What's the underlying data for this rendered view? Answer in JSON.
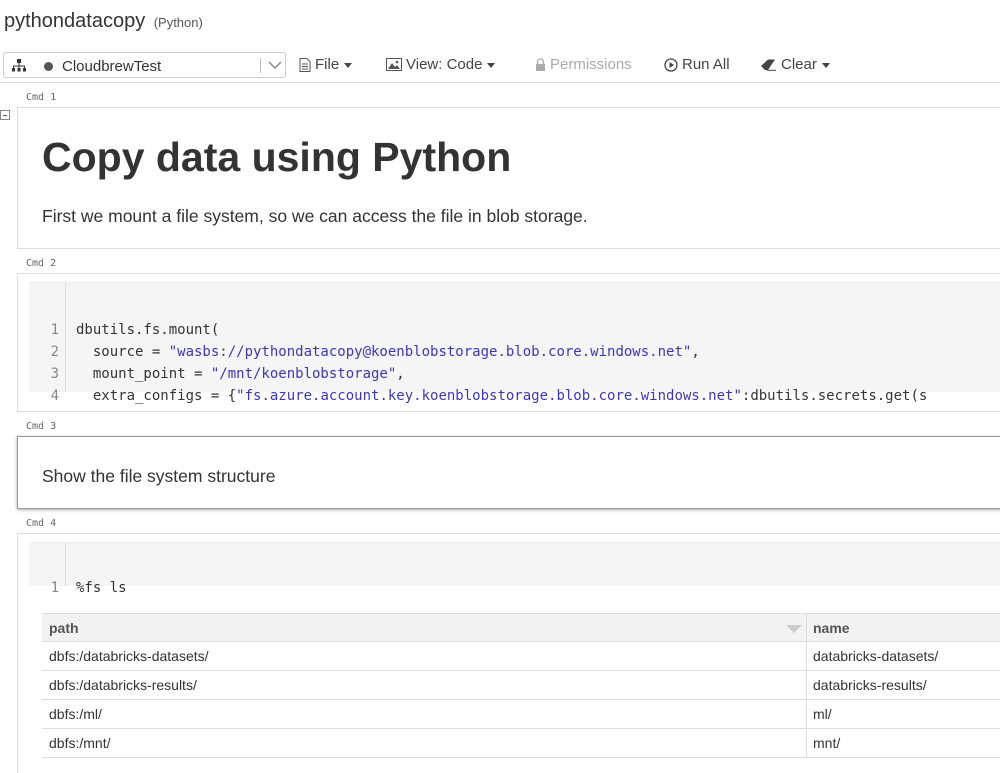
{
  "notebook": {
    "title": "pythondatacopy",
    "language": "(Python)"
  },
  "toolbar": {
    "cluster_name": "CloudbrewTest",
    "file_label": "File",
    "view_label": "View: Code",
    "permissions_label": "Permissions",
    "run_all_label": "Run All",
    "clear_label": "Clear"
  },
  "cells": {
    "cmd1": {
      "label": "Cmd 1",
      "heading": "Copy data using Python",
      "text": "First we mount a file system, so we can access the file in blob storage."
    },
    "cmd2": {
      "label": "Cmd 2",
      "lines": [
        {
          "num": "1",
          "a": "dbutils.fs.mount(",
          "s": "",
          "b": ""
        },
        {
          "num": "2",
          "a": "  source = ",
          "s": "\"wasbs://pythondatacopy@koenblobstorage.blob.core.windows.net\"",
          "b": ","
        },
        {
          "num": "3",
          "a": "  mount_point = ",
          "s": "\"/mnt/koenblobstorage\"",
          "b": ","
        },
        {
          "num": "4",
          "a": "  extra_configs = {",
          "s": "\"fs.azure.account.key.koenblobstorage.blob.core.windows.net\"",
          "b": ":dbutils.secrets.get(s"
        }
      ]
    },
    "cmd3": {
      "label": "Cmd 3",
      "text": "Show the file system structure"
    },
    "cmd4": {
      "label": "Cmd 4",
      "line_num": "1",
      "code": "%fs ls",
      "table": {
        "columns": [
          "path",
          "name"
        ],
        "rows": [
          [
            "dbfs:/databricks-datasets/",
            "databricks-datasets/"
          ],
          [
            "dbfs:/databricks-results/",
            "databricks-results/"
          ],
          [
            "dbfs:/ml/",
            "ml/"
          ],
          [
            "dbfs:/mnt/",
            "mnt/"
          ]
        ]
      }
    }
  },
  "colors": {
    "string": "#3b35c4",
    "border": "#dddddd",
    "code_bg": "#f5f5f5"
  }
}
